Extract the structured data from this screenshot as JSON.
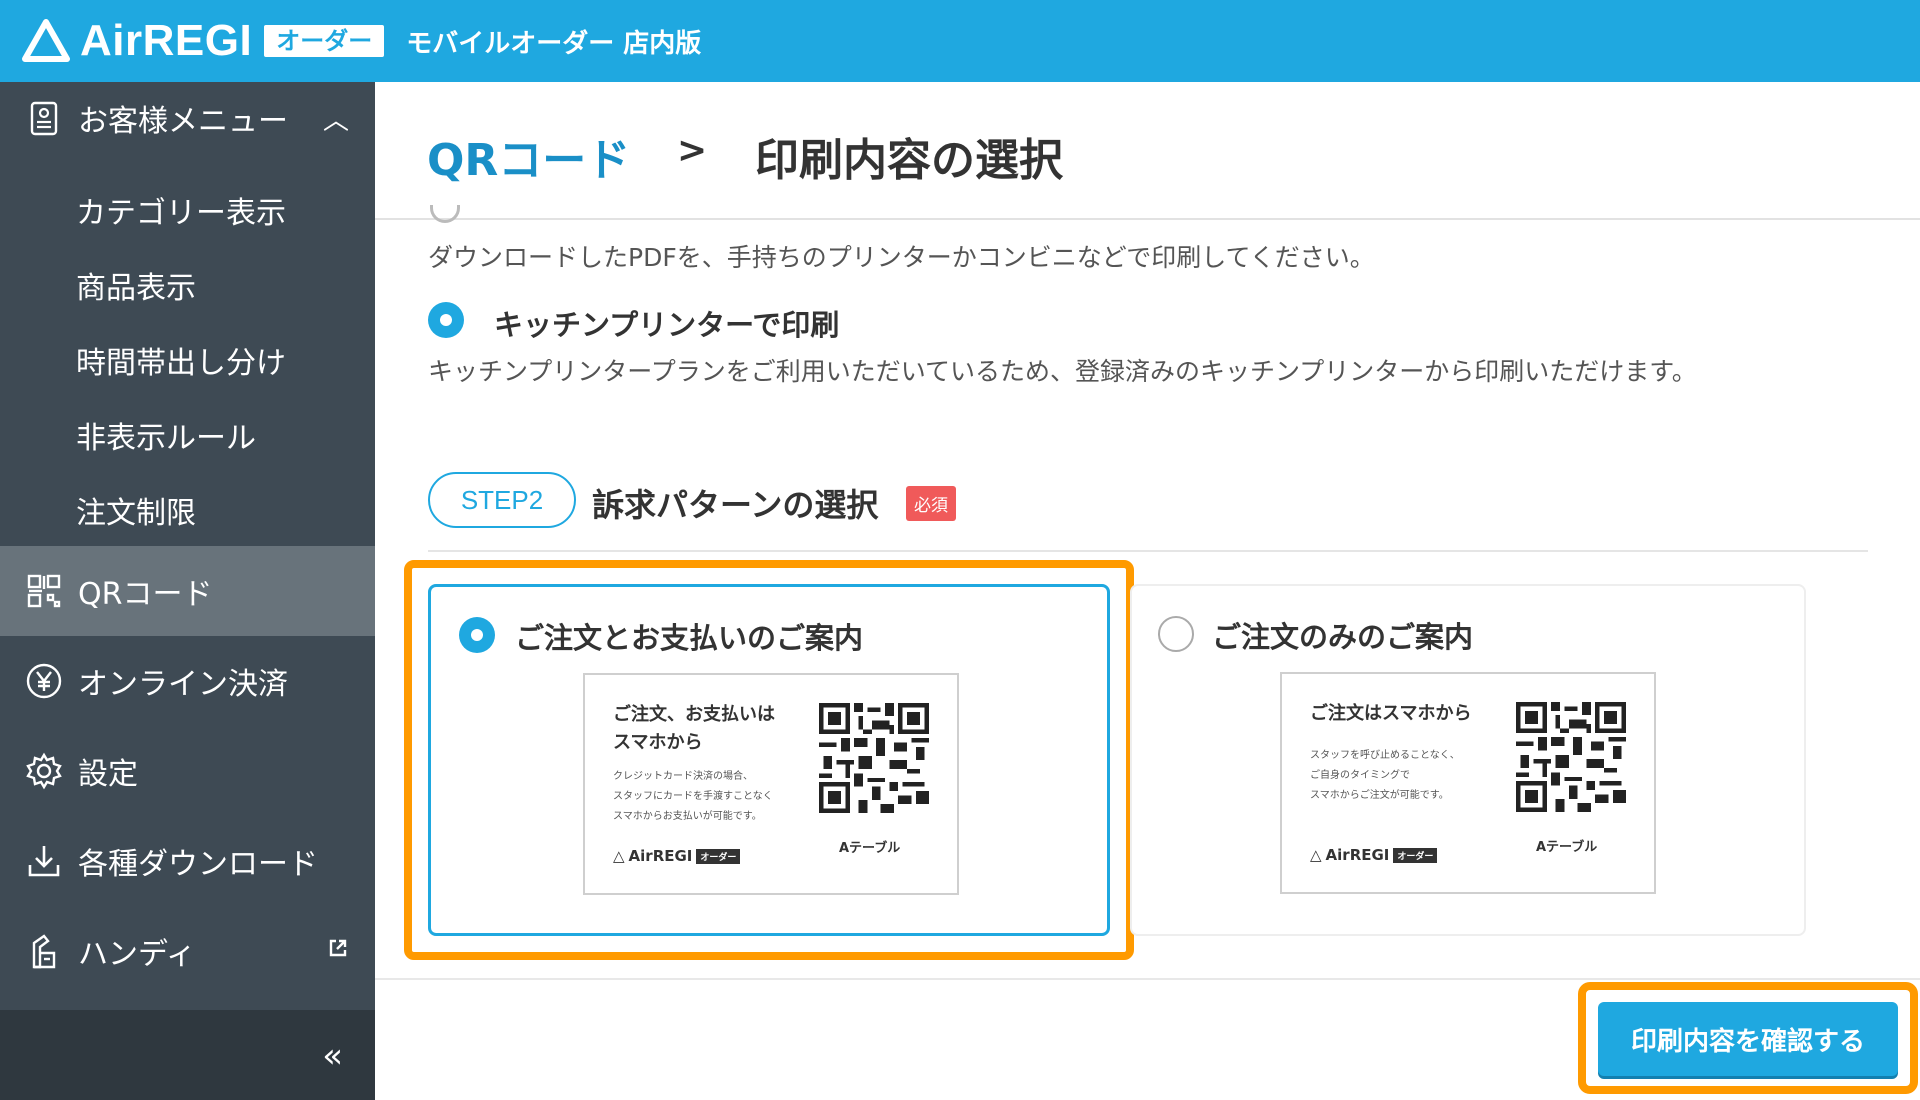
{
  "header": {
    "brand": "AirREGI",
    "badge": "オーダー",
    "subtitle": "モバイルオーダー 店内版",
    "brand_color": "#1fa8e0"
  },
  "sidebar": {
    "customer_menu": {
      "label": "お客様メニュー",
      "icon": "menu-card-icon",
      "expanded": true
    },
    "sub_items": [
      "カテゴリー表示",
      "商品表示",
      "時間帯出し分け",
      "非表示ルール",
      "注文制限"
    ],
    "items": [
      {
        "label": "QRコード",
        "icon": "qr-code-icon",
        "active": true
      },
      {
        "label": "オンライン決済",
        "icon": "yen-icon"
      },
      {
        "label": "設定",
        "icon": "gear-icon"
      },
      {
        "label": "各種ダウンロード",
        "icon": "download-icon"
      },
      {
        "label": "ハンディ",
        "icon": "handy-device-icon"
      }
    ],
    "collapse_glyph": "«"
  },
  "breadcrumb": {
    "link": "QRコード",
    "separator": ">",
    "current": "印刷内容の選択"
  },
  "step1": {
    "download_desc": "ダウンロードしたPDFを、手持ちのプリンターかコンビニなどで印刷してください。",
    "kitchen_option": "キッチンプリンターで印刷",
    "kitchen_desc": "キッチンプリンタープランをご利用いただいているため、登録済みのキッチンプリンターから印刷いただけます。"
  },
  "step2": {
    "pill": "STEP2",
    "title": "訴求パターンの選択",
    "required": "必須",
    "options": [
      {
        "title": "ご注文とお支払いのご案内",
        "selected": true,
        "preview_head": [
          "ご注文、お支払いは",
          "スマホから"
        ],
        "preview_body": [
          "クレジットカード決済の場合、",
          "スタッフにカードを手渡すことなく",
          "スマホからお支払いが可能です。"
        ],
        "preview_logo": "AirREGI",
        "preview_logo_badge": "オーダー",
        "preview_table": "Aテーブル"
      },
      {
        "title": "ご注文のみのご案内",
        "selected": false,
        "preview_head": [
          "ご注文はスマホから"
        ],
        "preview_body": [
          "スタッフを呼び止めることなく、",
          "ご自身のタイミングで",
          "スマホからご注文が可能です。"
        ],
        "preview_logo": "AirREGI",
        "preview_logo_badge": "オーダー",
        "preview_table": "Aテーブル"
      }
    ]
  },
  "footer": {
    "confirm_label": "印刷内容を確認する"
  },
  "colors": {
    "highlight": "#ff9a00",
    "sidebar_bg": "#3e4a54",
    "required_badge": "#f05a5a"
  }
}
